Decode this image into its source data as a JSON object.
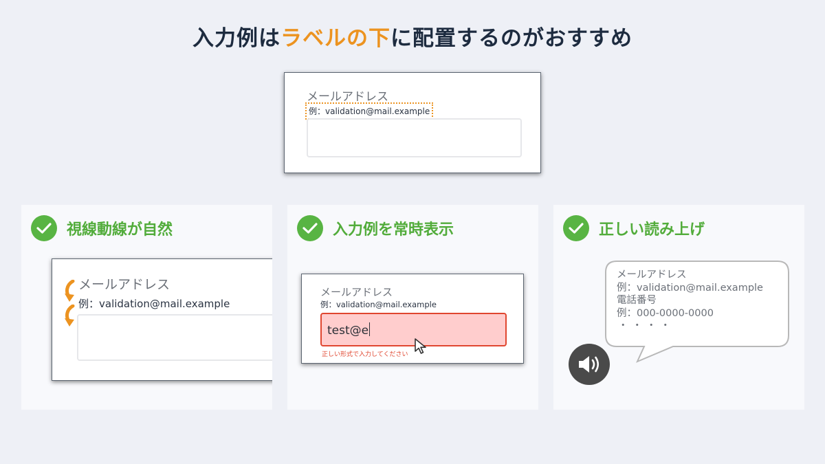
{
  "title": {
    "part1": "入力例は",
    "accent": "ラベルの下",
    "part2": "に配置するのがおすすめ"
  },
  "form": {
    "label": "メールアドレス",
    "example": "例：validation@mail.example"
  },
  "panels": [
    {
      "title": "視線動線が自然"
    },
    {
      "title": "入力例を常時表示",
      "typed_value": "test@e",
      "error_message": "正しい形式で入力してください"
    },
    {
      "title": "正しい読み上げ"
    }
  ],
  "speech": {
    "lines": [
      "メールアドレス",
      "例：validation@mail.example",
      "電話番号",
      "例：000-0000-0000",
      "・・・・"
    ]
  },
  "colors": {
    "accent": "#ec9320",
    "check_green": "#58b443",
    "panel_title_green": "#52ac3b",
    "error_red": "#e0462f",
    "error_fill": "#ffcdcd",
    "background": "#eef0f6"
  },
  "icons": [
    "check-icon",
    "arrow-down-icon",
    "mouse-cursor-icon",
    "speaker-icon"
  ]
}
